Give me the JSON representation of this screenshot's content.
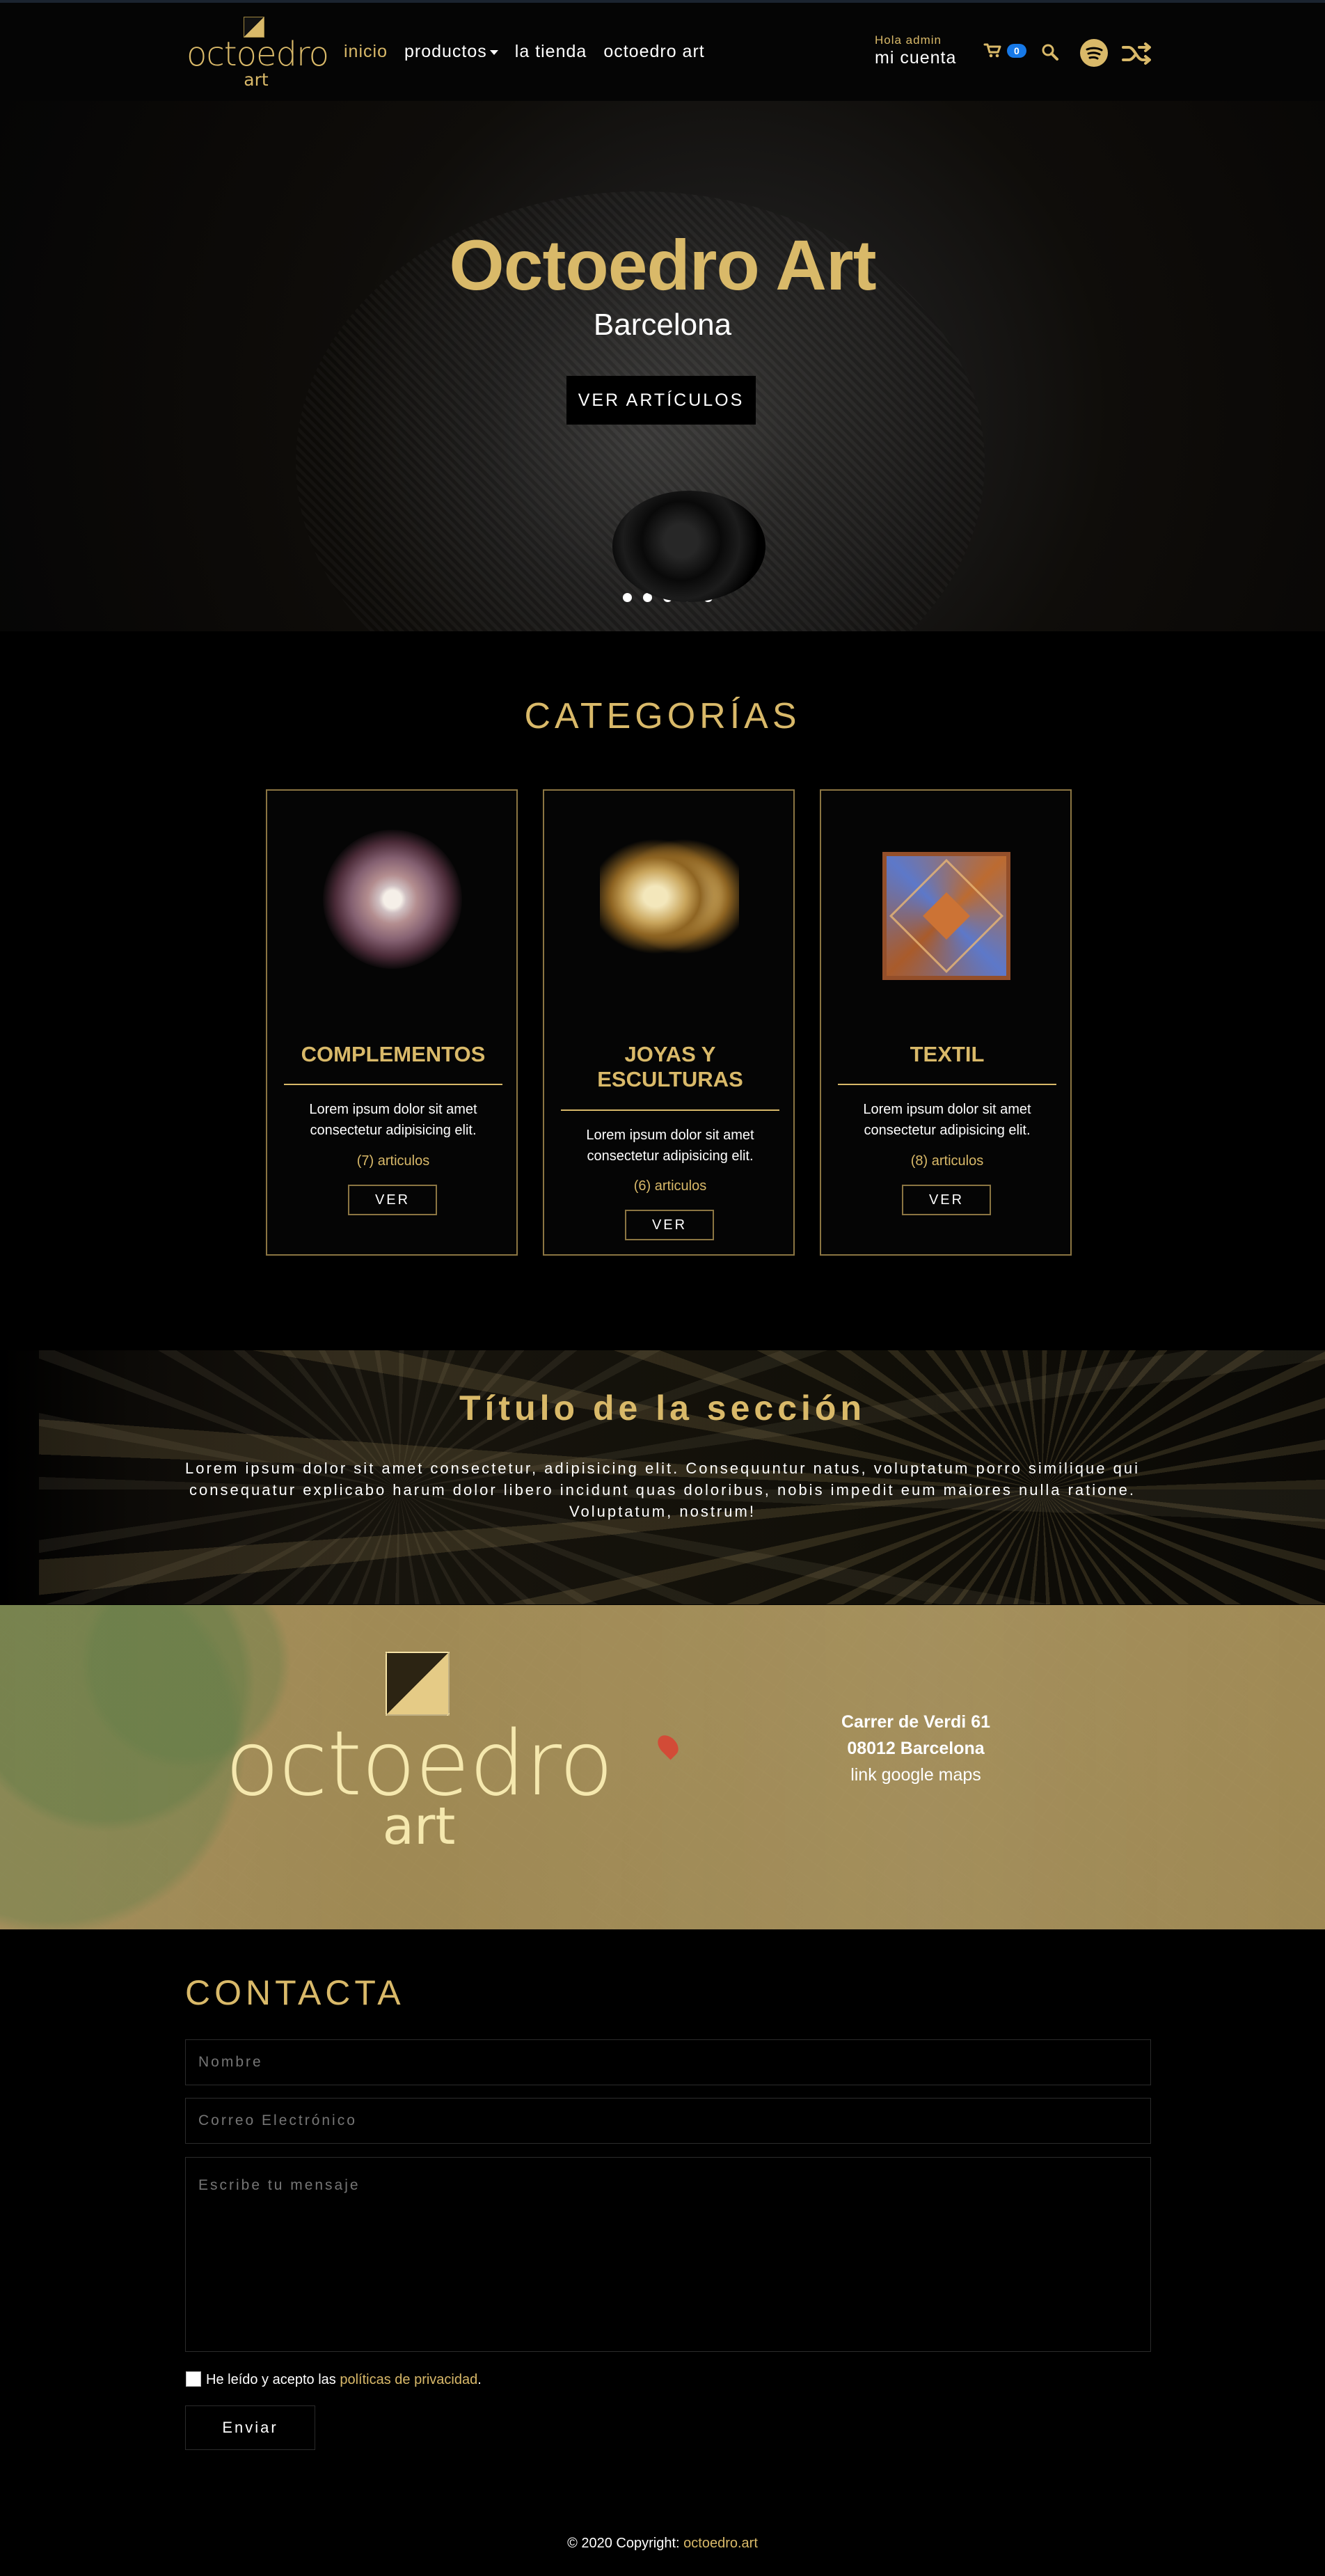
{
  "nav": {
    "logo_word": "octoedro",
    "logo_sub": "art",
    "links": [
      "inicio",
      "productos",
      "la tienda",
      "octoedro art"
    ],
    "account_greeting": "Hola admin",
    "account_link": "mi cuenta",
    "cart_count": "0"
  },
  "hero": {
    "title": "Octoedro Art",
    "subtitle": "Barcelona",
    "button": "VER ARTÍCULOS"
  },
  "categories": {
    "title": "CATEGORÍAS",
    "items": [
      {
        "title": "COMPLEMENTOS",
        "description": "Lorem ipsum dolor sit amet consectetur adipisicing elit.",
        "count": "(7) articulos",
        "button": "VER"
      },
      {
        "title": "JOYAS Y ESCULTURAS",
        "description": "Lorem ipsum dolor sit amet consectetur adipisicing elit.",
        "count": "(6) articulos",
        "button": "VER"
      },
      {
        "title": "TEXTIL",
        "description": "Lorem ipsum dolor sit amet consectetur adipisicing elit.",
        "count": "(8) articulos",
        "button": "VER"
      }
    ]
  },
  "section": {
    "title": "Título de la sección",
    "text": "Lorem ipsum dolor sit amet consectetur, adipisicing elit. Consequuntur natus, voluptatum porro similique qui consequatur explicabo harum dolor libero incidunt quas doloribus, nobis impedit eum maiores nulla ratione. Voluptatum, nostrum!"
  },
  "location": {
    "logo_word": "octoedro",
    "logo_sub": "art",
    "address_line1": "Carrer de Verdi 61",
    "address_line2": "08012 Barcelona",
    "maps_link": "link google maps"
  },
  "contact": {
    "title": "CONTACTA",
    "name_placeholder": "Nombre",
    "email_placeholder": "Correo Electrónico",
    "message_placeholder": "Escribe tu mensaje",
    "consent_prefix": "He leído y acepto las",
    "consent_link": "políticas de privacidad",
    "consent_suffix": ".",
    "submit": "Enviar"
  },
  "footer": {
    "prefix": "© 2020 Copyright:",
    "link": "octoedro.art"
  },
  "colors": {
    "gold": "#d9b969",
    "badge_blue": "#1779e8"
  },
  "icons": [
    "cart-icon",
    "search-icon",
    "spotify-icon",
    "shuffle-icon",
    "map-pin-icon"
  ]
}
